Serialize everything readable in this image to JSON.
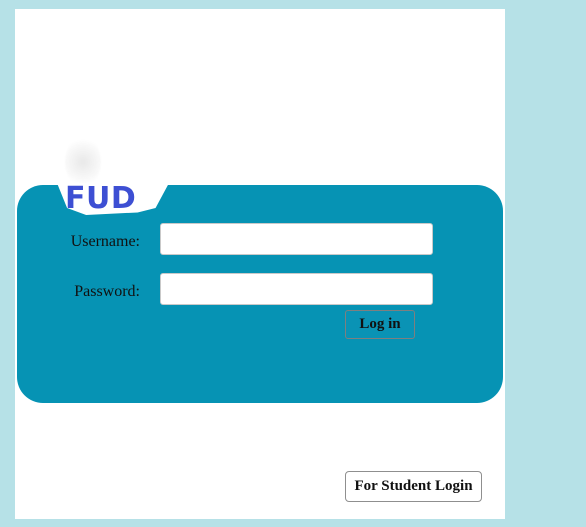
{
  "logo": {
    "text": "FUD",
    "color": "#3d4fd3"
  },
  "colors": {
    "page_background": "#b6e1e7",
    "panel": "#0693b4",
    "card": "#ffffff"
  },
  "form": {
    "username": {
      "label": "Username:",
      "value": "",
      "placeholder": ""
    },
    "password": {
      "label": "Password:",
      "value": "",
      "placeholder": ""
    },
    "login_label": "Log in"
  },
  "student_login_label": "For Student Login"
}
